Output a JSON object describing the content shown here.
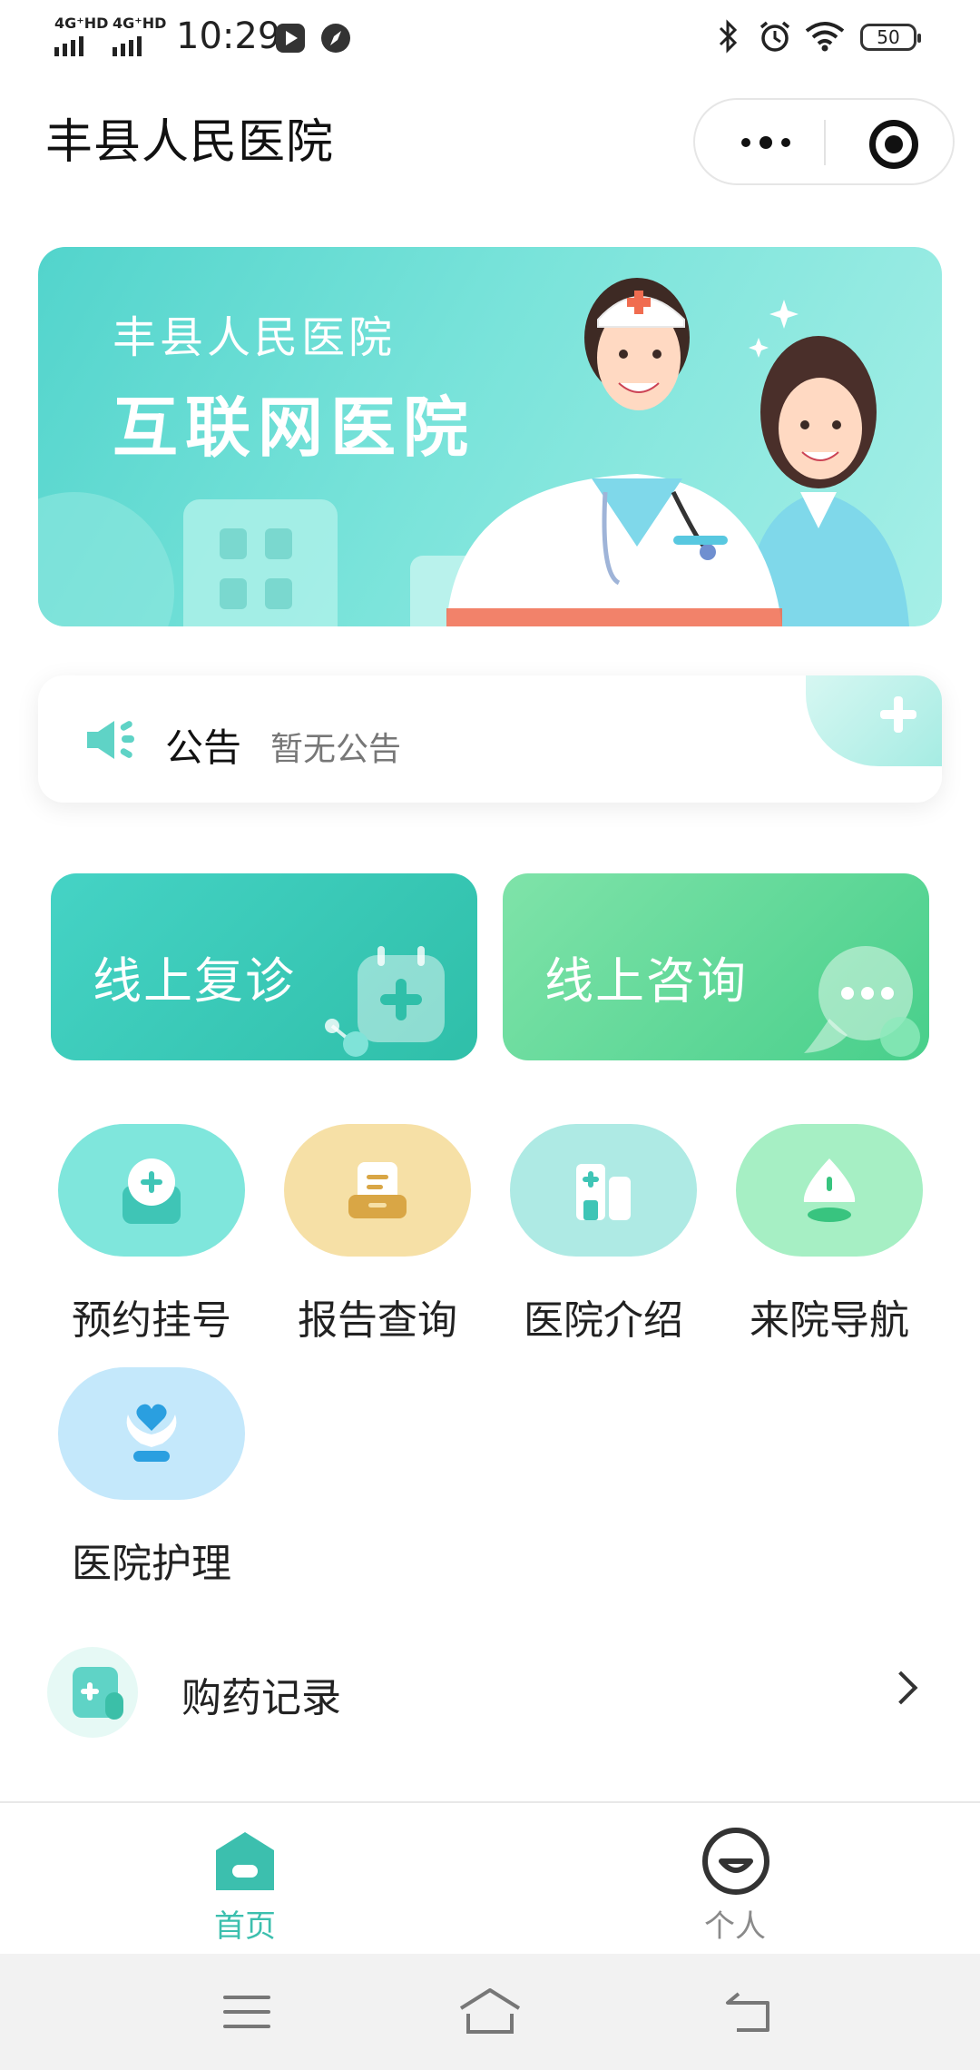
{
  "status_bar": {
    "net1": "4G⁺HD",
    "net2": "4G⁺HD",
    "time": "10:29",
    "battery": "50"
  },
  "title_bar": {
    "title": "丰县人民医院"
  },
  "banner": {
    "subtitle": "丰县人民医院",
    "title": "互联网医院"
  },
  "notice": {
    "label": "公告",
    "text": "暂无公告"
  },
  "cards": [
    {
      "label": "线上复诊"
    },
    {
      "label": "线上咨询"
    }
  ],
  "grid": [
    {
      "label": "预约挂号",
      "icon": "clock-plus-icon",
      "color": "#7fe6dc"
    },
    {
      "label": "报告查询",
      "icon": "report-icon",
      "color": "#f6e0a6"
    },
    {
      "label": "医院介绍",
      "icon": "hospital-icon",
      "color": "#aeeae4"
    },
    {
      "label": "来院导航",
      "icon": "navigation-icon",
      "color": "#a6efc4"
    },
    {
      "label": "医院护理",
      "icon": "care-heart-icon",
      "color": "#c4e8fb"
    }
  ],
  "list": [
    {
      "label": "购药记录",
      "icon": "medicine-record-icon"
    }
  ],
  "tabs": [
    {
      "label": "首页",
      "active": true,
      "color": "#3cbfae"
    },
    {
      "label": "个人",
      "active": false,
      "color": "#8a8a8a"
    }
  ]
}
